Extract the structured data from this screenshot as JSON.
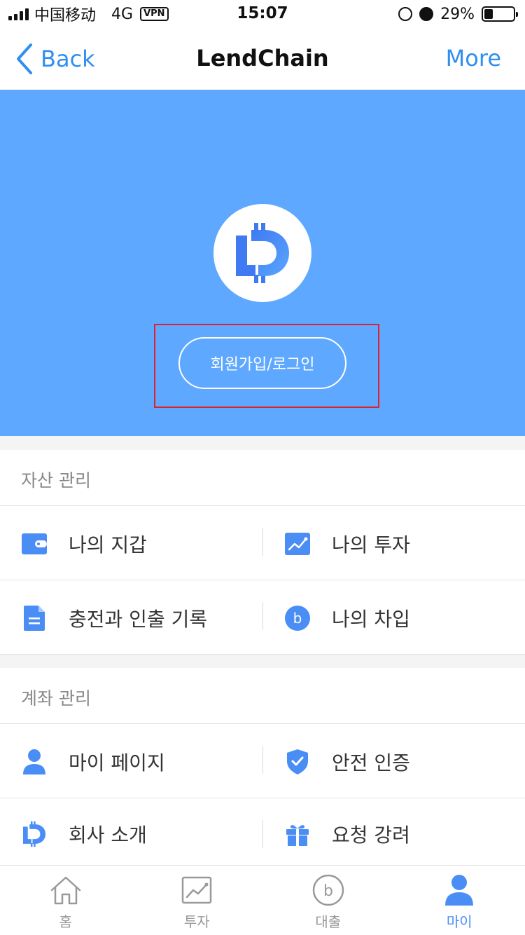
{
  "status_bar": {
    "carrier": "中国移动",
    "network": "4G",
    "vpn": "VPN",
    "time": "15:07",
    "battery": "29%",
    "battery_level": 0.29
  },
  "nav": {
    "back_label": "Back",
    "title": "LendChain",
    "more_label": "More"
  },
  "hero": {
    "login_label": "회원가입/로그인"
  },
  "sections": [
    {
      "title": "자산 관리",
      "rows": [
        [
          {
            "label": "나의 지갑",
            "icon": "wallet-icon"
          },
          {
            "label": "나의 투자",
            "icon": "chart-icon"
          }
        ],
        [
          {
            "label": "충전과 인출 기록",
            "icon": "document-icon"
          },
          {
            "label": "나의 차입",
            "icon": "coin-b-icon"
          }
        ]
      ]
    },
    {
      "title": "계좌 관리",
      "rows": [
        [
          {
            "label": "마이 페이지",
            "icon": "person-icon"
          },
          {
            "label": "안전 인증",
            "icon": "shield-check-icon"
          }
        ],
        [
          {
            "label": "회사 소개",
            "icon": "lendchain-logo-icon"
          },
          {
            "label": "요청 강려",
            "icon": "gift-icon"
          }
        ]
      ]
    }
  ],
  "tabs": [
    {
      "label": "홈",
      "icon": "home-icon"
    },
    {
      "label": "투자",
      "icon": "chart-icon"
    },
    {
      "label": "대출",
      "icon": "coin-b-icon"
    },
    {
      "label": "마이",
      "icon": "person-icon",
      "active": true
    }
  ],
  "colors": {
    "accent": "#2f8ff0",
    "hero_bg": "#5ea8ff",
    "icon_blue": "#4a8ef5",
    "highlight": "#e0202a"
  }
}
